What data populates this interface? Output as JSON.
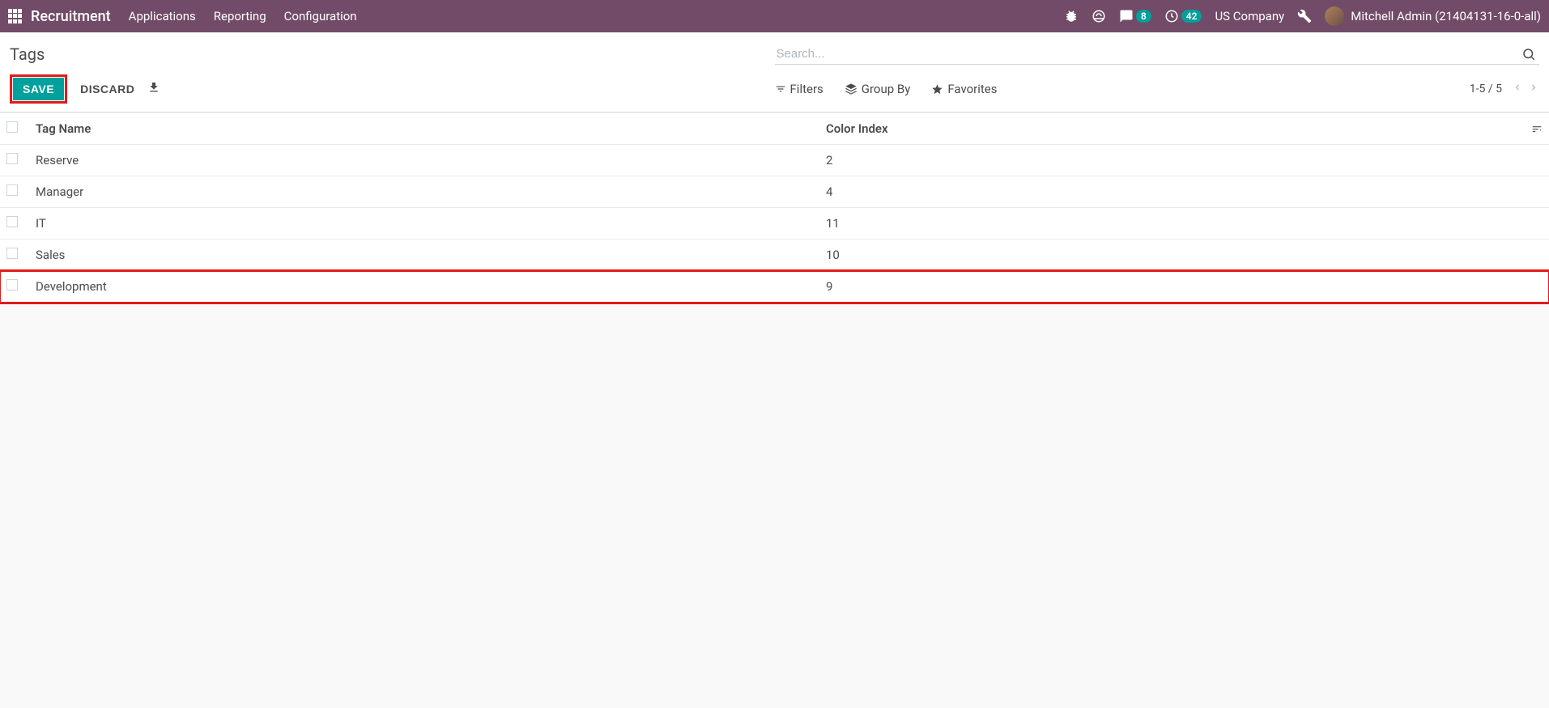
{
  "navbar": {
    "brand": "Recruitment",
    "links": [
      "Applications",
      "Reporting",
      "Configuration"
    ],
    "messages_badge": "8",
    "activities_badge": "42",
    "company": "US Company",
    "user": "Mitchell Admin (21404131-16-0-all)"
  },
  "breadcrumb": "Tags",
  "search": {
    "placeholder": "Search..."
  },
  "actions": {
    "save": "SAVE",
    "discard": "DISCARD"
  },
  "search_options": {
    "filters": "Filters",
    "group_by": "Group By",
    "favorites": "Favorites"
  },
  "pager": "1-5 / 5",
  "columns": {
    "name": "Tag Name",
    "color": "Color Index"
  },
  "rows": [
    {
      "name": "Reserve",
      "color": "2"
    },
    {
      "name": "Manager",
      "color": "4"
    },
    {
      "name": "IT",
      "color": "11"
    },
    {
      "name": "Sales",
      "color": "10"
    },
    {
      "name": "Development",
      "color": "9"
    }
  ]
}
